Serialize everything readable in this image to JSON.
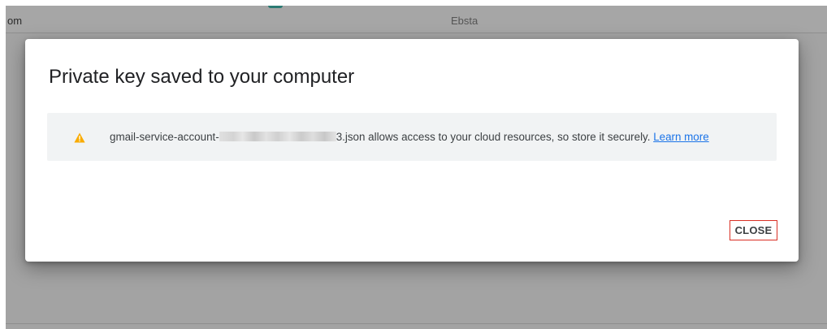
{
  "background": {
    "left_text": "om",
    "center_text": "Ebsta"
  },
  "dialog": {
    "title": "Private key saved to your computer",
    "notice": {
      "icon": "warning-icon",
      "icon_color": "#f9ab00",
      "filename_prefix": "gmail-service-account-",
      "filename_suffix": "3.json",
      "message": " allows access to your cloud resources, so store it securely. ",
      "link_label": "Learn more"
    },
    "close_label": "CLOSE"
  },
  "colors": {
    "link": "#1a73e8",
    "close_outline": "#d93025",
    "notice_bg": "#f1f3f4"
  }
}
